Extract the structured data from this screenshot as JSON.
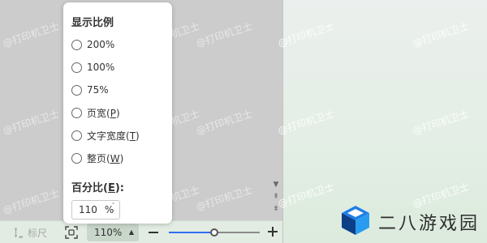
{
  "watermark_text": "@打印机卫士",
  "zoom_popup": {
    "title": "显示比例",
    "options": [
      {
        "label": "200%",
        "accel": ""
      },
      {
        "label": "100%",
        "accel": ""
      },
      {
        "label": "75%",
        "accel": ""
      },
      {
        "label": "页宽(",
        "accel": "P",
        "suffix": ")"
      },
      {
        "label": "文字宽度(",
        "accel": "T",
        "suffix": ")"
      },
      {
        "label": "整页(",
        "accel": "W",
        "suffix": ")"
      }
    ],
    "percent_label_prefix": "百分比(",
    "percent_label_accel": "E",
    "percent_label_suffix": "):",
    "percent_value": "110",
    "percent_unit": "%"
  },
  "status_bar": {
    "ruler_label": "标尺",
    "zoom_level": "110%",
    "zoom_slider_fraction": 0.5
  },
  "brand": {
    "name": "二八游戏园"
  },
  "colors": {
    "slider_fill": "#2f6cf0",
    "logo_blue": "#1e7ee6",
    "logo_dark": "#0d3f87"
  }
}
